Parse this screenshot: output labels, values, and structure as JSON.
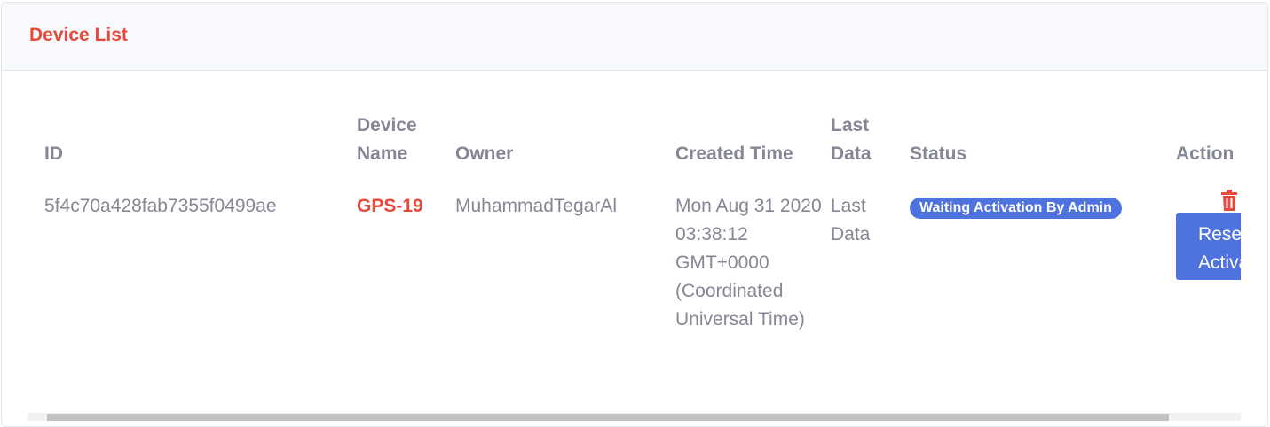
{
  "card": {
    "title": "Device List"
  },
  "table": {
    "headers": {
      "id": "ID",
      "device_name": "Device Name",
      "owner": "Owner",
      "created_time": "Created Time",
      "last_data": "Last Data",
      "status": "Status",
      "action": "Action"
    },
    "rows": [
      {
        "id": "5f4c70a428fab7355f0499ae",
        "device_name": "GPS-19",
        "owner": "MuhammadTegarAl",
        "created_time": "Mon Aug 31 2020 03:38:12 GMT+0000 (Coordinated Universal Time)",
        "last_data": "Last Data",
        "status": "Waiting Activation By Admin",
        "reset_label": "Reset Activation"
      }
    ]
  },
  "colors": {
    "accent_red": "#e74a3b",
    "primary_blue": "#4e73df",
    "text_gray": "#858796"
  },
  "icons": {
    "delete": "trash-icon"
  }
}
